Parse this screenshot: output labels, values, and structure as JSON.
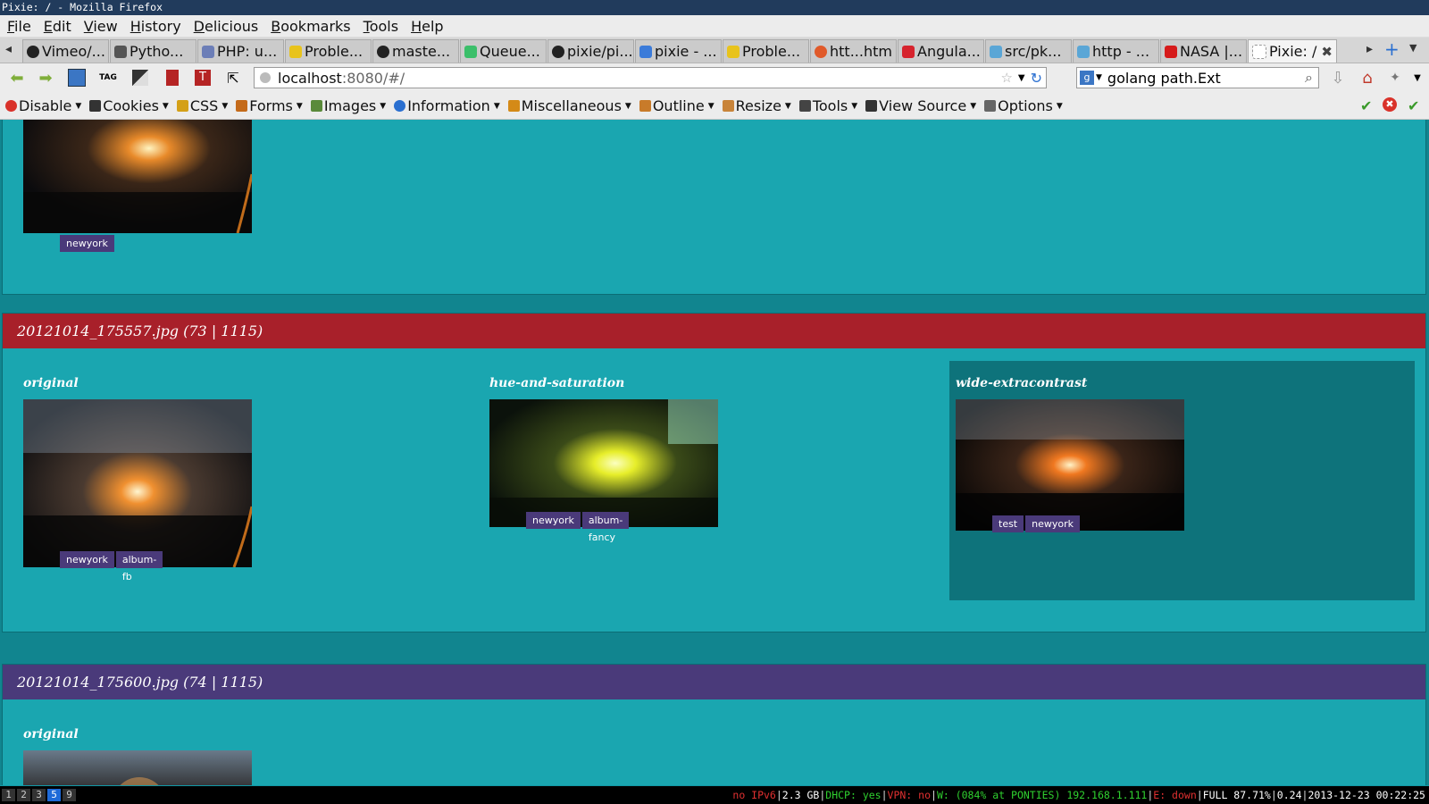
{
  "window": {
    "title": "Pixie: / - Mozilla Firefox"
  },
  "menu": [
    "File",
    "Edit",
    "View",
    "History",
    "Delicious",
    "Bookmarks",
    "Tools",
    "Help"
  ],
  "tabs": [
    {
      "label": "Vimeo/...",
      "color": "#222222"
    },
    {
      "label": "Pytho...",
      "color": "#555555"
    },
    {
      "label": "PHP: u...",
      "color": "#6c7eb7"
    },
    {
      "label": "Proble...",
      "color": "#e8c31c"
    },
    {
      "label": "maste...",
      "color": "#222222"
    },
    {
      "label": "Queue...",
      "color": "#3bbf6a"
    },
    {
      "label": "pixie/pi...",
      "color": "#222222"
    },
    {
      "label": "pixie - ...",
      "color": "#3b7bd9"
    },
    {
      "label": "Proble...",
      "color": "#e8c31c"
    },
    {
      "label": "htt...htm",
      "color": "#e05a2a"
    },
    {
      "label": "Angula...",
      "color": "#d6232d"
    },
    {
      "label": "src/pk...",
      "color": "#5aa6d6"
    },
    {
      "label": "http - ...",
      "color": "#5aa6d6"
    },
    {
      "label": "NASA |...",
      "color": "#d61b1b"
    },
    {
      "label": "Pixie: /",
      "color": "#ffffff"
    }
  ],
  "url": {
    "host": "localhost",
    "rest": ":8080/#/"
  },
  "search": {
    "value": "golang path.Ext"
  },
  "devtools": {
    "items": [
      "Disable",
      "Cookies",
      "CSS",
      "Forms",
      "Images",
      "Information",
      "Miscellaneous",
      "Outline",
      "Resize",
      "Tools",
      "View Source",
      "Options"
    ],
    "colors": [
      "#d9322a",
      "#333333",
      "#d4a017",
      "#c46a1a",
      "#5a8a3a",
      "#2a6fd0",
      "#d48a17",
      "#c87b2a",
      "#c8843a",
      "#444444",
      "#333333",
      "#666666"
    ]
  },
  "cards": [
    {
      "variants": [
        {
          "tags": [
            "newyork"
          ]
        }
      ]
    },
    {
      "title": "20121014_175557.jpg (73 | 1115)",
      "header_color": "#a8202a",
      "variants": [
        {
          "name": "original",
          "tags": [
            "newyork",
            "album-fb"
          ]
        },
        {
          "name": "hue-and-saturation",
          "tags": [
            "newyork",
            "album-fancy"
          ]
        },
        {
          "name": "wide-extracontrast",
          "tags": [
            "test",
            "newyork"
          ],
          "selected": true
        }
      ]
    },
    {
      "title": "20121014_175600.jpg (74 | 1115)",
      "header_color": "#4a3a7a",
      "variants": [
        {
          "name": "original"
        }
      ]
    }
  ],
  "statusbar": {
    "workspaces": [
      "1",
      "2",
      "3",
      "5",
      "9"
    ],
    "current_workspace": "5",
    "ipv6": "no IPv6",
    "mem": "2.3 GB",
    "dhcp": "DHCP: yes",
    "vpn": "VPN: no",
    "wifi": "W: (084% at PONTIES) 192.168.1.111",
    "eth": "E: down",
    "battery": "FULL 87.71%",
    "load": "0.24",
    "datetime": "2013-12-23 00:22:25"
  }
}
